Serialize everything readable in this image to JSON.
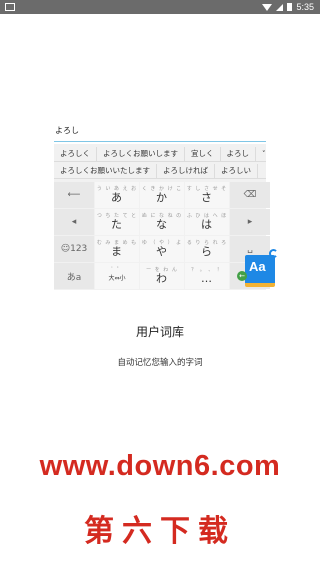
{
  "status_bar": {
    "time": "5:35",
    "icons": [
      "app-notification-icon",
      "wifi-icon",
      "signal-icon",
      "battery-icon"
    ]
  },
  "illustration": {
    "input_text": "よろし",
    "candidates_row1": [
      "よろしく",
      "よろしくお願いします",
      "宜しく",
      "よろし"
    ],
    "candidates_row2": [
      "よろしくお願いいたします",
      "よろしければ",
      "よろしい"
    ],
    "more_icon": "˅",
    "keys": {
      "back": "⟵",
      "left": "◂",
      "symbols": "☺123",
      "abc": "あa",
      "a": {
        "small": "う  い あ え お",
        "main": "あ"
      },
      "ka": {
        "small": "く  き か け こ",
        "main": "か"
      },
      "sa": {
        "small": "す  し さ せ そ",
        "main": "さ"
      },
      "ta": {
        "small": "つ  ち た て と",
        "main": "た"
      },
      "na": {
        "small": "ぬ  に な ね の",
        "main": "な"
      },
      "ha": {
        "small": "ふ  ひ は へ ほ",
        "main": "は"
      },
      "ma": {
        "small": "む  み ま め も",
        "main": "ま"
      },
      "ya": {
        "small": "ゆ  （ や ） よ",
        "main": "や"
      },
      "ra": {
        "small": "る  り ら れ ろ",
        "main": "ら"
      },
      "dakuten": {
        "small": "゛゜",
        "main": "大⇔小"
      },
      "wa": {
        "small": "ー  を わ ん",
        "main": "わ"
      },
      "punct": {
        "small": "？  。 、 ！",
        "main": "…"
      },
      "delete": "⌫",
      "right": "▸",
      "space": "␣",
      "enter": "↵"
    },
    "badge_text": "Aa"
  },
  "feature": {
    "title": "用户词库",
    "description": "自动记忆您输入的字词"
  },
  "watermark": {
    "url": "www.down6.com",
    "name": "第六下载"
  }
}
